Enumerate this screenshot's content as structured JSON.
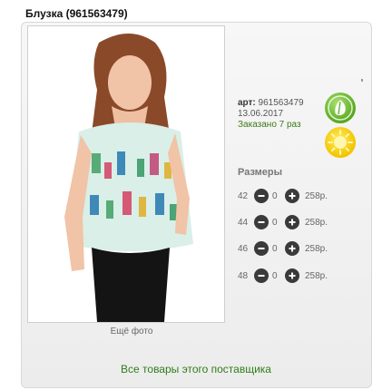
{
  "product": {
    "title": "Блузка (961563479)",
    "article_label": "арт:",
    "article_value": "961563479",
    "date": "13.06.2017",
    "ordered": "Заказано 7 раз"
  },
  "photo": {
    "more_label": "Ещё фото"
  },
  "sizes": {
    "header": "Размеры",
    "rows": [
      {
        "size": "42",
        "qty": "0",
        "price": "258р."
      },
      {
        "size": "44",
        "qty": "0",
        "price": "258р."
      },
      {
        "size": "46",
        "qty": "0",
        "price": "258р."
      },
      {
        "size": "48",
        "qty": "0",
        "price": "258р."
      }
    ]
  },
  "supplier_link": "Все товары этого поставщика",
  "icons": {
    "eco": "leaf-icon",
    "sun": "sun-icon",
    "minus": "minus-circle-icon",
    "plus": "plus-circle-icon"
  },
  "colors": {
    "eco_green": "#57a81d",
    "sun_yellow": "#f2c400",
    "link_green": "#2f7d1a",
    "button_dark": "#3a3a3a"
  }
}
